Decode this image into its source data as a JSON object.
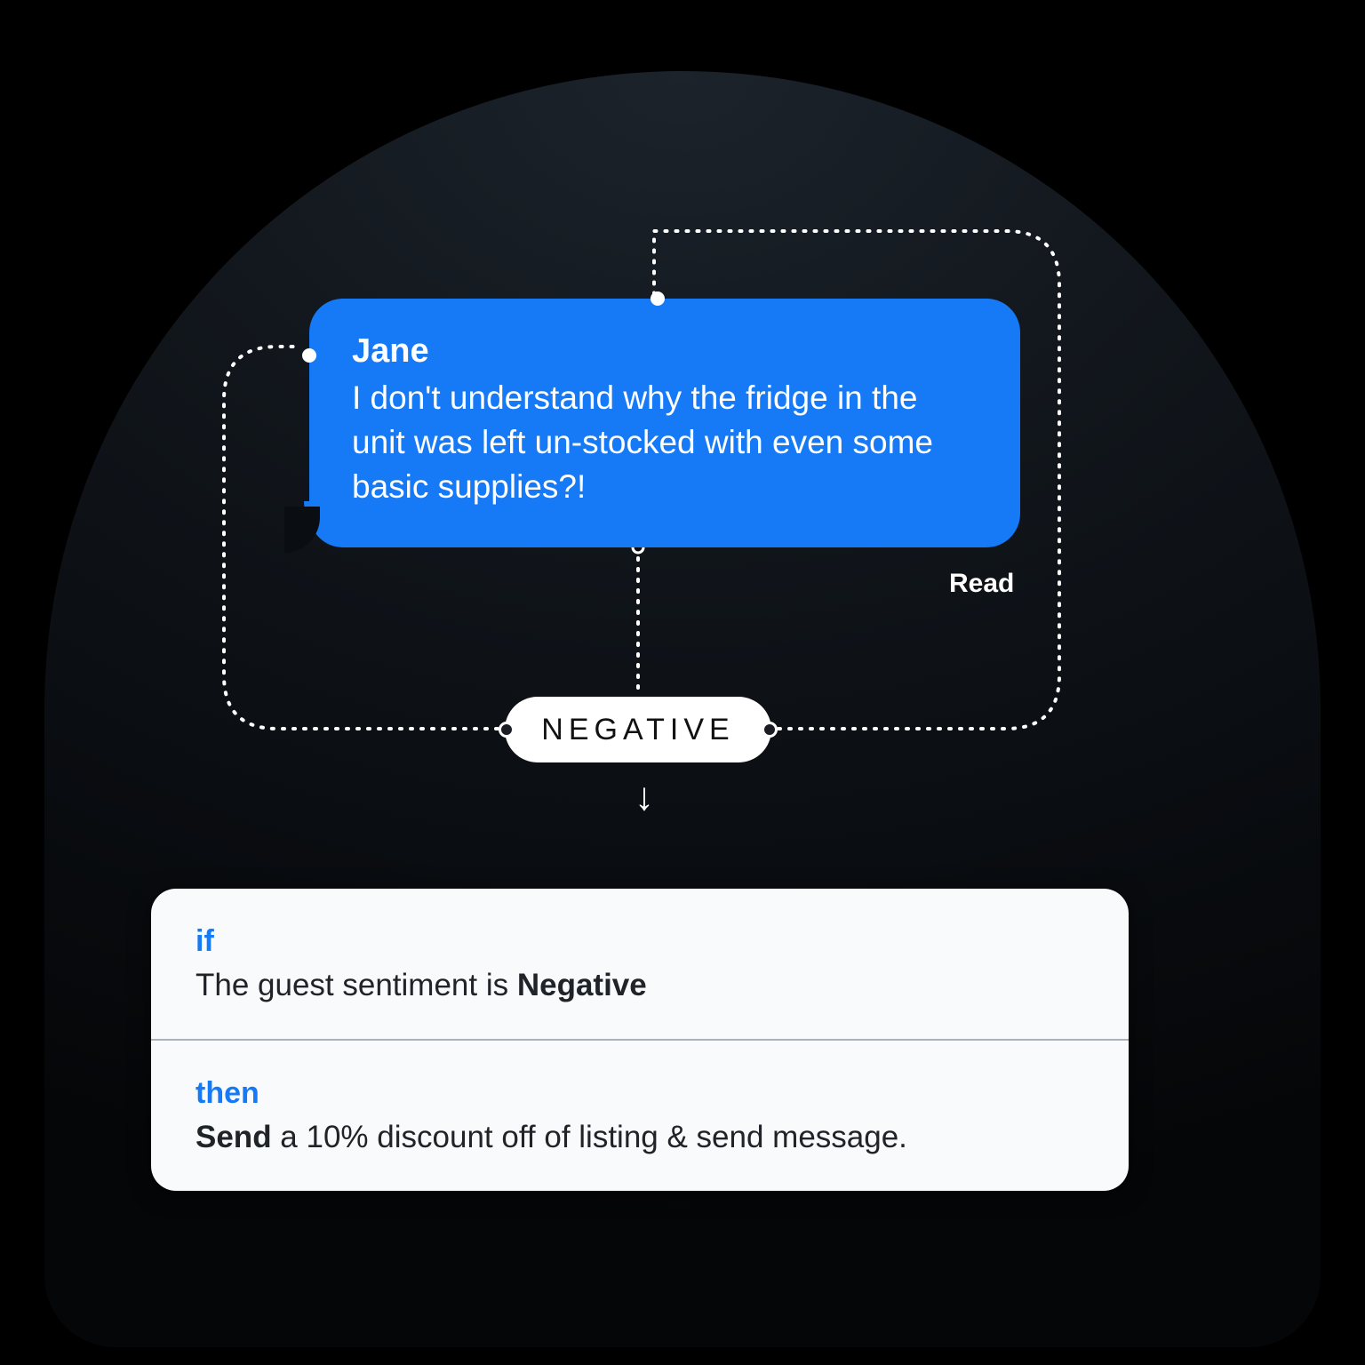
{
  "message": {
    "sender": "Jane",
    "body": "I don't understand why the fridge in the unit was left un-stocked with even some basic supplies?!",
    "status": "Read"
  },
  "sentiment_label": "NEGATIVE",
  "arrow": "↓",
  "rule": {
    "if_kw": "if",
    "if_prefix": "The guest sentiment is ",
    "if_value": "Negative",
    "then_kw": "then",
    "then_action": "Send",
    "then_rest": " a 10% discount off of listing & send message."
  }
}
